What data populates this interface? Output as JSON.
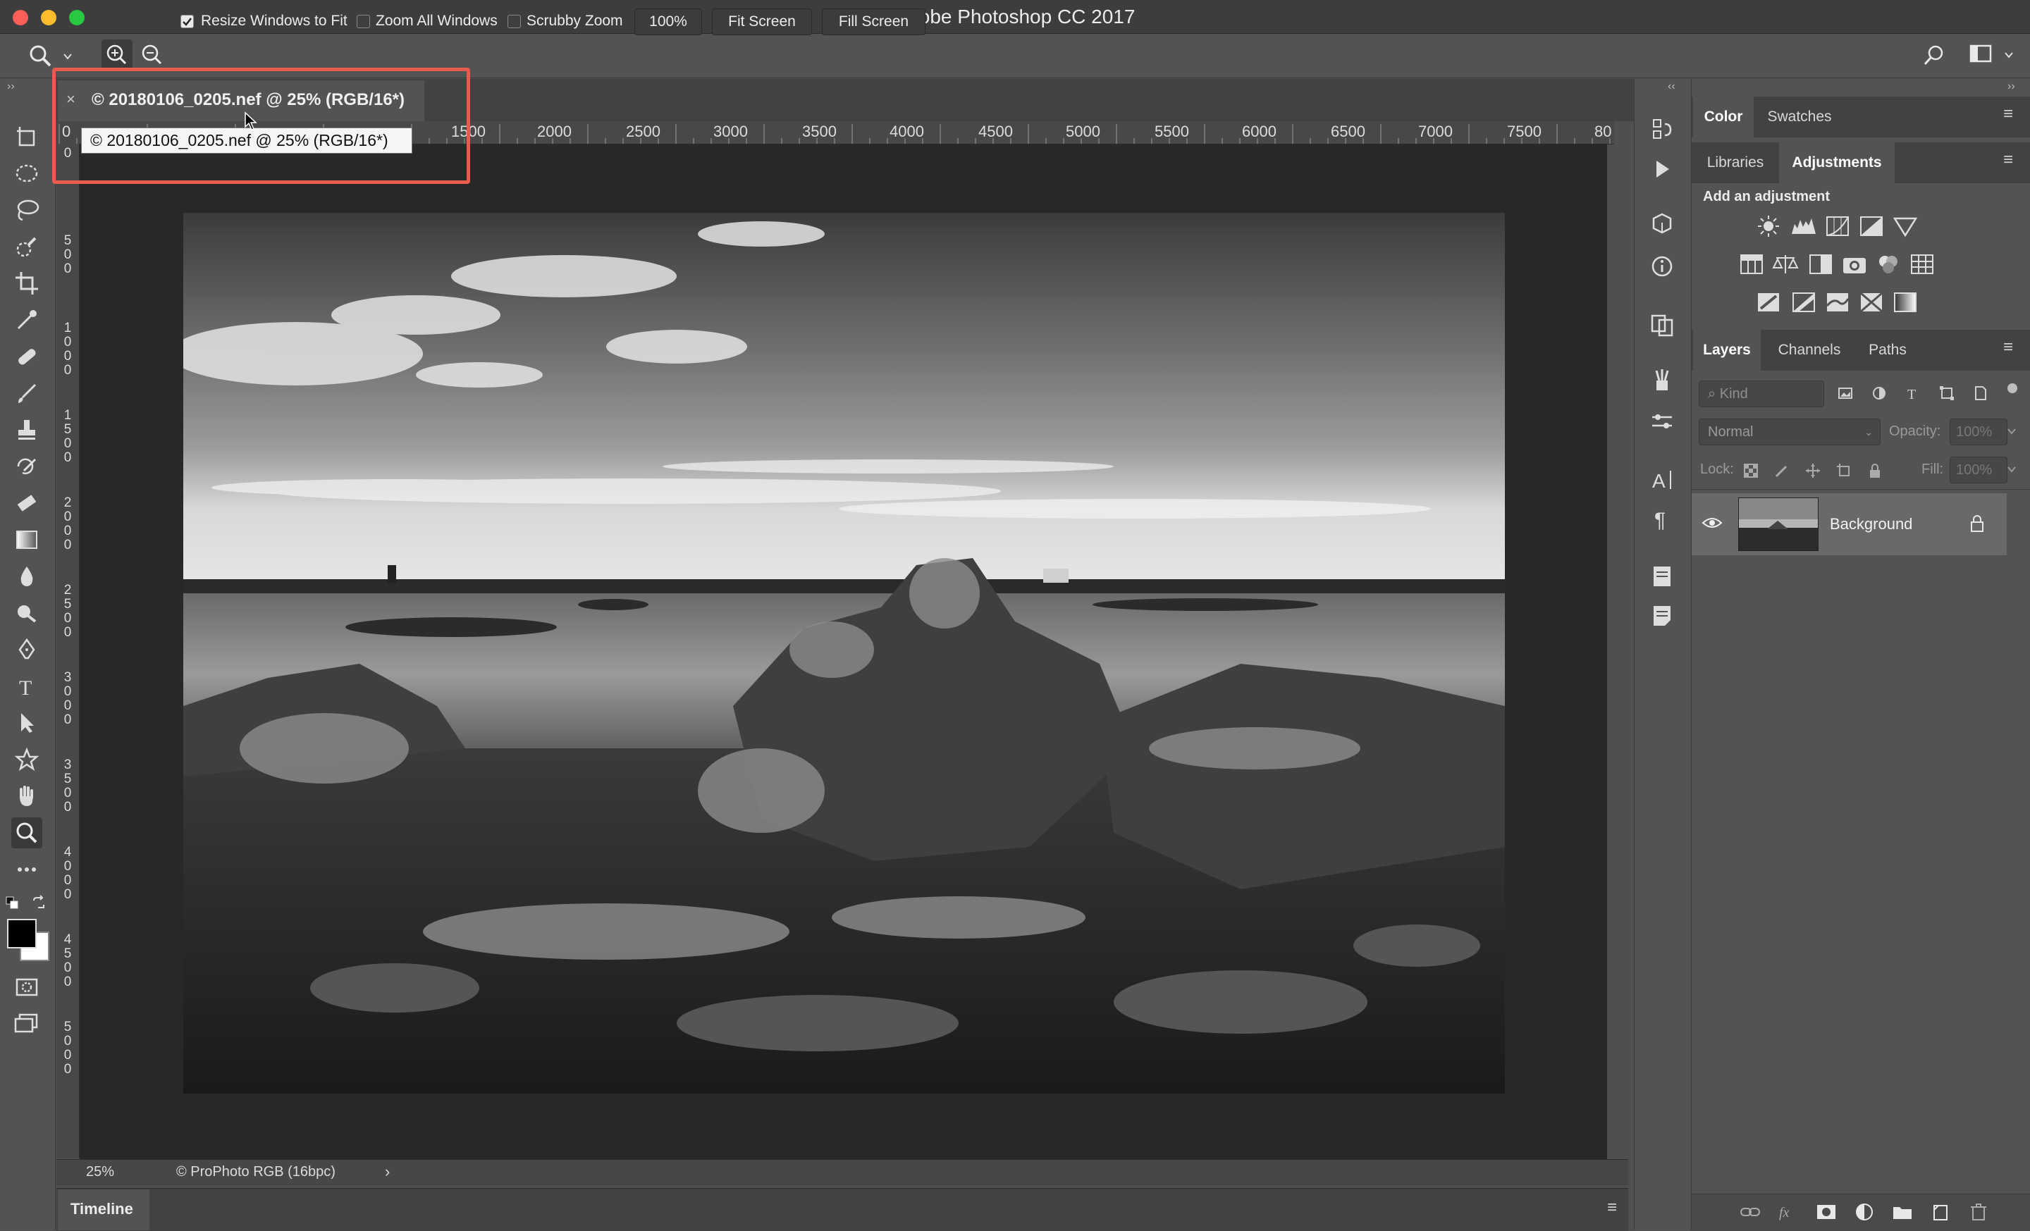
{
  "window": {
    "title": "Adobe Photoshop CC 2017",
    "traffic_lights": {
      "close": "#fc5f57",
      "minimize": "#fdbc2e",
      "zoom": "#28c840"
    }
  },
  "options_bar": {
    "tool_icon": "zoom-icon",
    "resize_windows_label": "Resize Windows to Fit",
    "resize_windows_checked": true,
    "zoom_all_label": "Zoom All Windows",
    "zoom_all_checked": false,
    "scrubby_label": "Scrubby Zoom",
    "scrubby_checked": false,
    "zoom_100_label": "100%",
    "fit_screen_label": "Fit Screen",
    "fill_screen_label": "Fill Screen"
  },
  "document": {
    "tab_title": "© 20180106_0205.nef @ 25% (RGB/16*)",
    "close_glyph": "×",
    "tooltip": "© 20180106_0205.nef @ 25% (RGB/16*)",
    "highlight_color": "#e95a4f",
    "ruler_h_labels": [
      "0",
      "1500",
      "2000",
      "2500",
      "3000",
      "3500",
      "4000",
      "4500",
      "5000",
      "5500",
      "6000",
      "6500",
      "7000",
      "7500",
      "80"
    ],
    "ruler_v_labels": [
      "0",
      "500",
      "1000",
      "1500",
      "2000",
      "2500",
      "3000",
      "3500",
      "4000",
      "4500",
      "5000"
    ]
  },
  "status_bar": {
    "zoom": "25%",
    "profile": "© ProPhoto RGB (16bpc)",
    "arrow": "›"
  },
  "timeline": {
    "label": "Timeline"
  },
  "panels": {
    "color_tabs": [
      "Color",
      "Swatches"
    ],
    "adj_tabs": [
      "Libraries",
      "Adjustments"
    ],
    "add_adjustment": "Add an adjustment",
    "layers_tabs": [
      "Layers",
      "Channels",
      "Paths"
    ],
    "kind_placeholder": "Kind",
    "blend_mode": "Normal",
    "opacity_label": "Opacity:",
    "opacity_value": "100%",
    "lock_label": "Lock:",
    "fill_label": "Fill:",
    "fill_value": "100%",
    "layer_name": "Background"
  }
}
